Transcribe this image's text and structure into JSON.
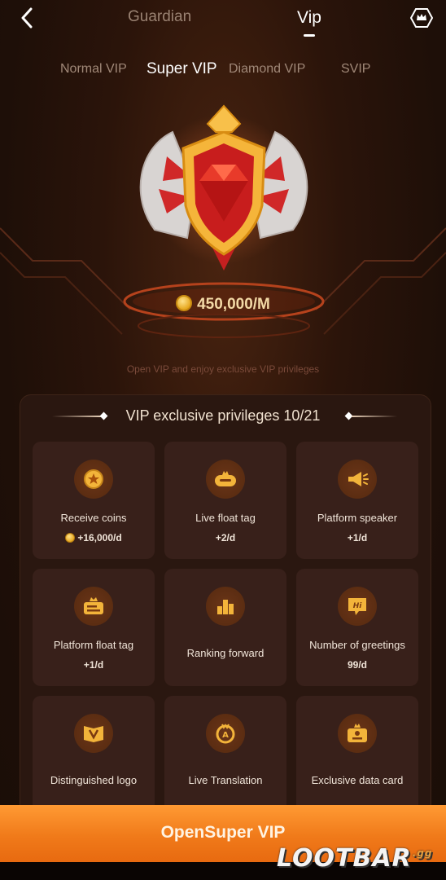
{
  "nav": {
    "tabs": [
      "Guardian",
      "Vip"
    ],
    "active_tab": "Vip"
  },
  "sub_tabs": {
    "items": [
      "Normal VIP",
      "Super VIP",
      "Diamond VIP",
      "SVIP"
    ],
    "active": "Super VIP"
  },
  "badge": {
    "price": "450,000/M",
    "tagline": "Open VIP and enjoy exclusive VIP privileges"
  },
  "privileges": {
    "title": "VIP exclusive privileges 10/21",
    "items": [
      {
        "name": "Receive coins",
        "value": "+16,000/d",
        "icon": "coin-star-icon"
      },
      {
        "name": "Live float tag",
        "value": "+2/d",
        "icon": "float-tag-icon"
      },
      {
        "name": "Platform speaker",
        "value": "+1/d",
        "icon": "megaphone-icon"
      },
      {
        "name": "Platform float tag",
        "value": "+1/d",
        "icon": "crown-banner-icon"
      },
      {
        "name": "Ranking forward",
        "value": "",
        "icon": "podium-icon"
      },
      {
        "name": "Number of greetings",
        "value": "99/d",
        "icon": "hi-bubble-icon"
      },
      {
        "name": "Distinguished logo",
        "value": "",
        "icon": "v-frame-icon"
      },
      {
        "name": "Live Translation",
        "value": "",
        "icon": "translate-icon"
      },
      {
        "name": "Exclusive data card",
        "value": "",
        "icon": "data-card-icon"
      }
    ]
  },
  "cta": {
    "label": "OpenSuper VIP"
  },
  "watermark": {
    "text": "LOOTBAR",
    "suffix": ".gg"
  },
  "colors": {
    "background": "#1e0f08",
    "card": "#38201a",
    "accent_orange": "#f07a1a",
    "gold": "#f3d9a6"
  }
}
